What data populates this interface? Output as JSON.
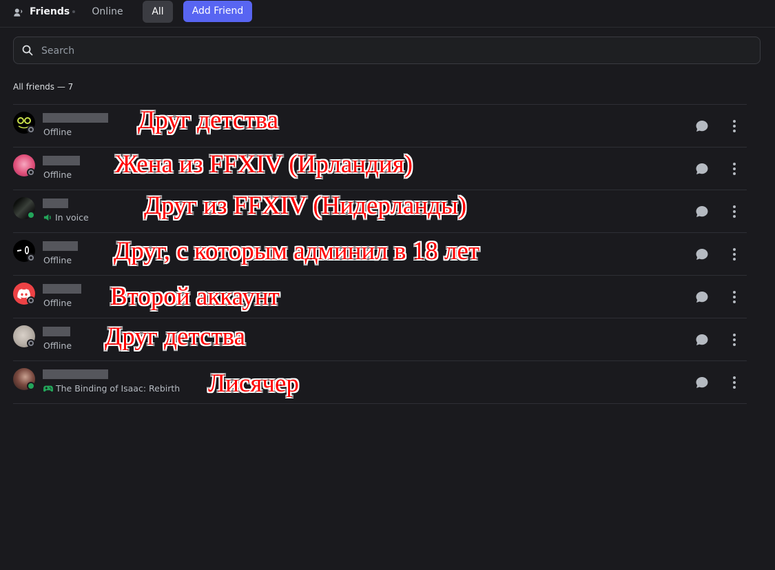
{
  "header": {
    "title": "Friends",
    "tabs": [
      {
        "label": "Online"
      },
      {
        "label": "All"
      }
    ],
    "add_friend_label": "Add Friend"
  },
  "search": {
    "placeholder": "Search"
  },
  "friends_count_label": "All friends — 7",
  "friends": [
    {
      "status": "offline",
      "status_text": "Offline",
      "annotation": "Друг детства",
      "avatar_color": "#000000"
    },
    {
      "status": "offline",
      "status_text": "Offline",
      "annotation": "Жена из FFXIV (Ирландия)",
      "avatar_color": "#e0507a"
    },
    {
      "status": "online",
      "status_text": "In voice",
      "annotation": "Друг из FFXIV (Нидерланды)",
      "avatar_color": "#2a2d2a"
    },
    {
      "status": "offline",
      "status_text": "Offline",
      "annotation": "Друг, с которым админил в 18 лет",
      "avatar_color": "#000000"
    },
    {
      "status": "offline",
      "status_text": "Offline",
      "annotation": "Второй аккаунт",
      "avatar_color": "#ed4245"
    },
    {
      "status": "offline",
      "status_text": "Offline",
      "annotation": "Друг детства",
      "avatar_color": "#b8b0a8"
    },
    {
      "status": "online",
      "status_text": "The Binding of Isaac: Rebirth",
      "annotation": "Лисячер",
      "avatar_color": "#5a3a34"
    }
  ],
  "colors": {
    "accent": "#5865f2",
    "online": "#23a55a",
    "offline": "#80848e",
    "annotation": "#ff0000"
  }
}
